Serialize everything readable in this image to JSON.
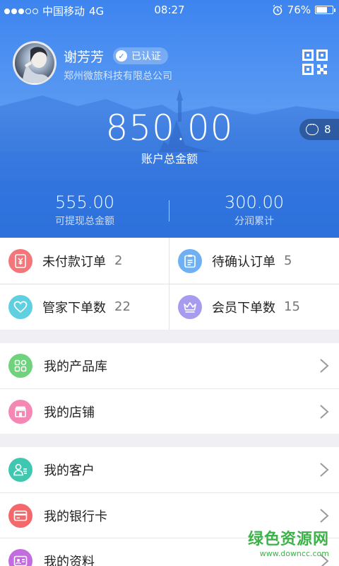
{
  "status_bar": {
    "carrier": "中国移动",
    "network": "4G",
    "time": "08:27",
    "battery_text": "76%",
    "battery_level": 0.76
  },
  "profile": {
    "name": "谢芳芳",
    "verified_label": "已认证",
    "company": "郑州微旅科技有限总公司"
  },
  "account": {
    "balance": "850.00",
    "balance_label": "账户总金额",
    "message_count": "8",
    "withdrawable": "555.00",
    "withdrawable_label": "可提现总金额",
    "profit_share": "300.00",
    "profit_share_label": "分润累计"
  },
  "orders": [
    {
      "label": "未付款订单",
      "count": "2",
      "color": "#f4767a",
      "icon": "receipt-yen-icon"
    },
    {
      "label": "待确认订单",
      "count": "5",
      "color": "#6fb0f5",
      "icon": "clipboard-icon"
    },
    {
      "label": "管家下单数",
      "count": "22",
      "color": "#5ed0e0",
      "icon": "heart-icon"
    },
    {
      "label": "会员下单数",
      "count": "15",
      "color": "#a79bf0",
      "icon": "crown-icon"
    }
  ],
  "menu_group_1": [
    {
      "label": "我的产品库",
      "color": "#6ed37c",
      "icon": "grid-apps-icon"
    },
    {
      "label": "我的店铺",
      "color": "#f587b4",
      "icon": "store-icon"
    }
  ],
  "menu_group_2": [
    {
      "label": "我的客户",
      "color": "#40c7b0",
      "icon": "customer-icon"
    },
    {
      "label": "我的银行卡",
      "color": "#f4686b",
      "icon": "bank-card-icon"
    },
    {
      "label": "我的资料",
      "color": "#c36be0",
      "icon": "id-card-icon"
    }
  ],
  "watermark": {
    "title": "绿色资源网",
    "url": "www.downcc.com"
  },
  "colors": {
    "primary": "#3f86f0",
    "background": "#efeff4"
  }
}
